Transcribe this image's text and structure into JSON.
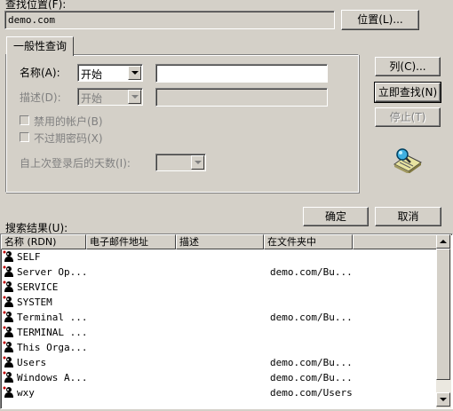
{
  "search_location": {
    "label": "查找位置(F):",
    "value": "demo.com",
    "browse_button": "位置(L)..."
  },
  "tab": {
    "label": "一般性查询"
  },
  "query": {
    "name_label": "名称(A):",
    "name_condition": "开始",
    "name_value": "",
    "desc_label": "描述(D):",
    "desc_condition": "开始",
    "disabled_accounts_label": "禁用的帐户(B)",
    "non_expiring_label": "不过期密码(X)",
    "days_since_logon_label": "自上次登录后的天数(I):"
  },
  "buttons": {
    "columns": "列(C)...",
    "find_now": "立即查找(N)",
    "stop": "停止(T)",
    "ok": "确定",
    "cancel": "取消"
  },
  "results": {
    "label": "搜索结果(U):",
    "columns": [
      "名称 (RDN)",
      "电子邮件地址",
      "描述",
      "在文件夹中"
    ],
    "rows": [
      {
        "name": "SELF",
        "folder": ""
      },
      {
        "name": "Server Op...",
        "folder": "demo.com/Bu..."
      },
      {
        "name": "SERVICE",
        "folder": ""
      },
      {
        "name": "SYSTEM",
        "folder": ""
      },
      {
        "name": "Terminal ...",
        "folder": "demo.com/Bu..."
      },
      {
        "name": "TERMINAL ...",
        "folder": ""
      },
      {
        "name": "This Orga...",
        "folder": ""
      },
      {
        "name": "Users",
        "folder": "demo.com/Bu..."
      },
      {
        "name": "Windows A...",
        "folder": "demo.com/Bu..."
      },
      {
        "name": "wxy",
        "folder": "demo.com/Users"
      }
    ]
  }
}
